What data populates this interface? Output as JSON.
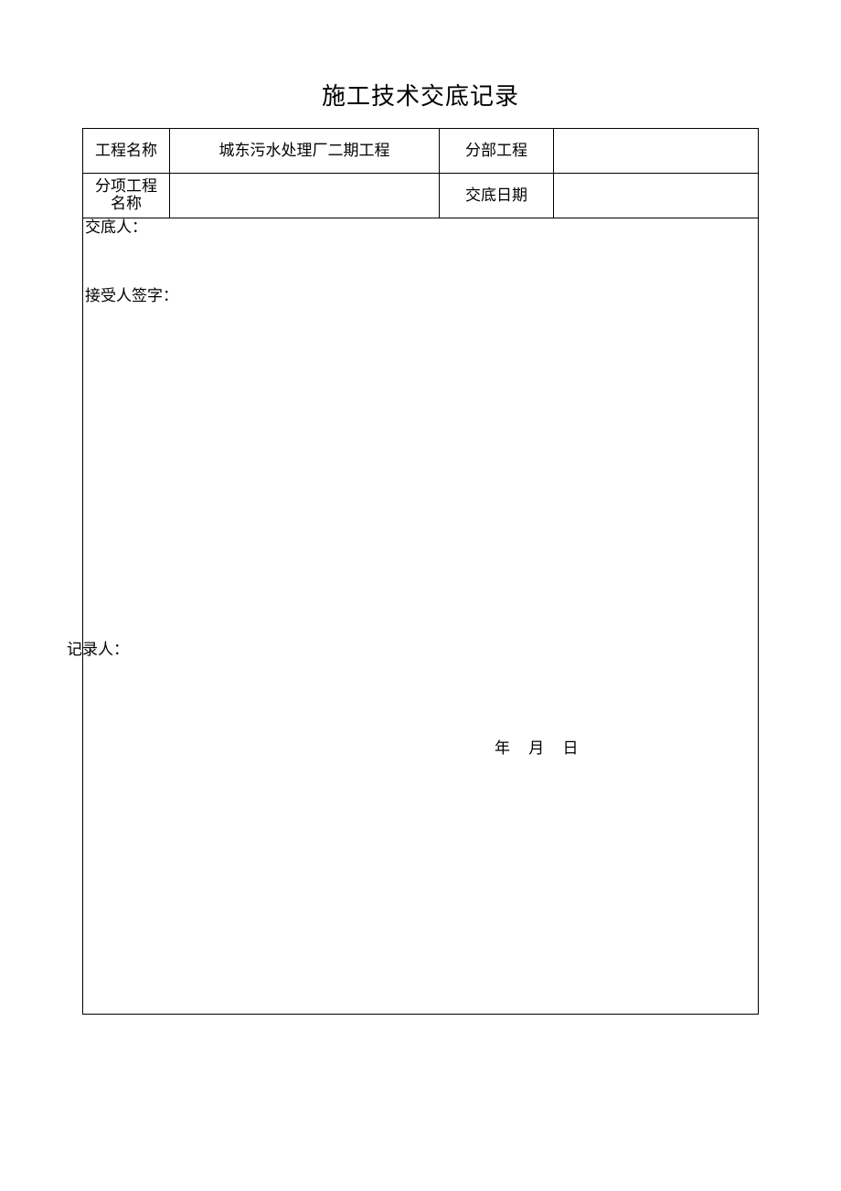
{
  "title": "施工技术交底记录",
  "header": {
    "row1": {
      "label1": "工程名称",
      "value1": "城东污水处理厂二期工程",
      "label2": "分部工程",
      "value2": ""
    },
    "row2": {
      "label1_line1": "分项工程",
      "label1_line2": "名称",
      "value1": "",
      "label2": "交底日期",
      "value2": ""
    }
  },
  "body": {
    "deliver_label": "交底人：",
    "receive_label": "接受人签字：",
    "record_label": "记录人：",
    "date_year": "年",
    "date_month": "月",
    "date_day": "日"
  }
}
